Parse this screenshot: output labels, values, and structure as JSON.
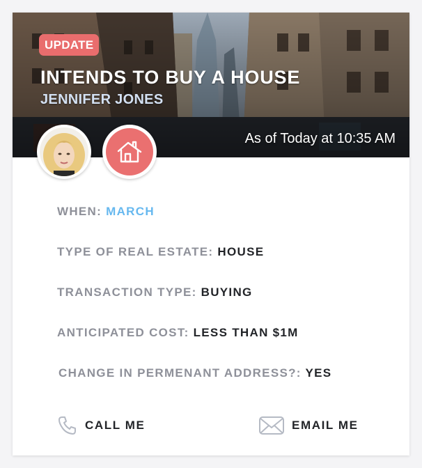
{
  "card": {
    "badge": "UPDATE",
    "title": "INTENDS TO BUY A HOUSE",
    "person_name": "JENNIFER JONES",
    "timestamp": "As of Today at 10:35 AM",
    "avatar_icon": "person-avatar",
    "category_icon": "house-icon",
    "accent_color": "#e96d6d",
    "highlight_color": "#66b8ef"
  },
  "details": [
    {
      "label": "WHEN:",
      "value": "MARCH"
    },
    {
      "label": "TYPE OF REAL ESTATE:",
      "value": "HOUSE"
    },
    {
      "label": "TRANSACTION TYPE:",
      "value": "BUYING"
    },
    {
      "label": "ANTICIPATED COST:",
      "value": "LESS THAN $1M"
    },
    {
      "label": "CHANGE IN PERMENANT ADDRESS?:",
      "value": "YES"
    }
  ],
  "actions": {
    "call": {
      "label": "CALL ME",
      "icon": "phone-icon"
    },
    "email": {
      "label": "EMAIL ME",
      "icon": "envelope-icon"
    }
  }
}
